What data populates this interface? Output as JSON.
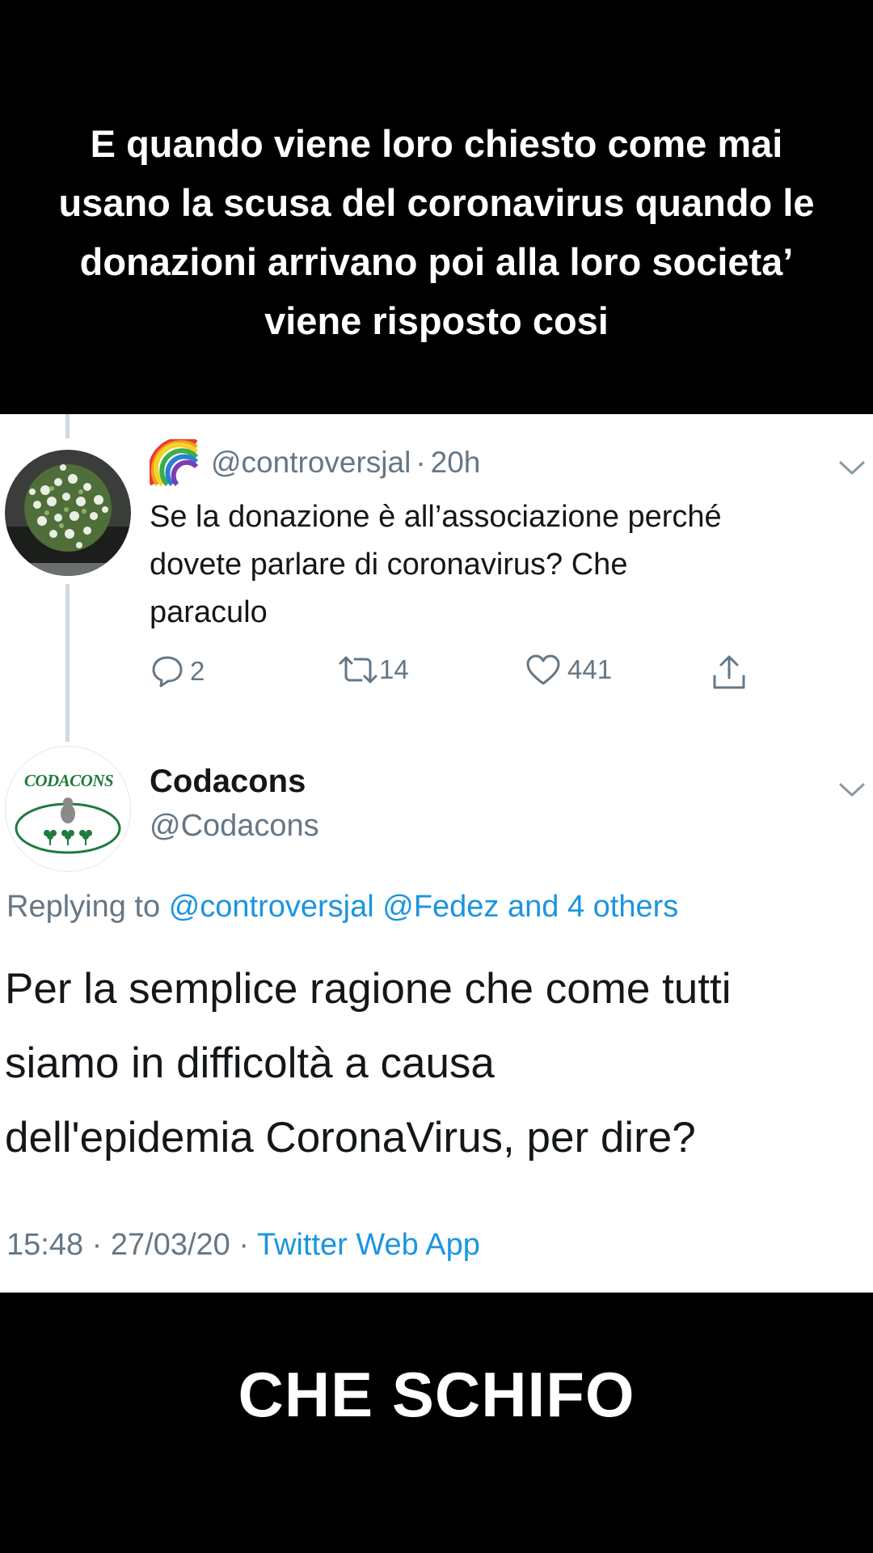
{
  "top_caption": "E quando viene loro chiesto come mai usano la scusa del coronavirus quando le donazioni arrivano poi alla loro societa’ viene risposto cosi",
  "reply_tweet": {
    "handle": "@controversjal",
    "separator": "·",
    "time": "20h",
    "text_lines": [
      "Se la donazione è all’associazione perché",
      "dovete parlare di coronavirus? Che",
      "paraculo"
    ],
    "replies": "2",
    "retweets": "14",
    "likes": "441"
  },
  "main_tweet": {
    "display_name": "Codacons",
    "handle": "@Codacons",
    "avatar_text": "CODACONS",
    "replying_prefix": "Replying to",
    "replying_to": "@controversjal @Fedez and 4 others",
    "text_lines": [
      "Per la semplice ragione che come tutti",
      "siamo in difficoltà a causa",
      "dell'epidemia CoronaVirus, per dire?"
    ],
    "time": "15:48",
    "date": "27/03/20",
    "separator": "·",
    "source": "Twitter Web App"
  },
  "bottom_caption": "CHE SCHIFO",
  "colors": {
    "muted": "#657786",
    "link": "#1b95e0",
    "codacons_green": "#1f7a3e"
  }
}
